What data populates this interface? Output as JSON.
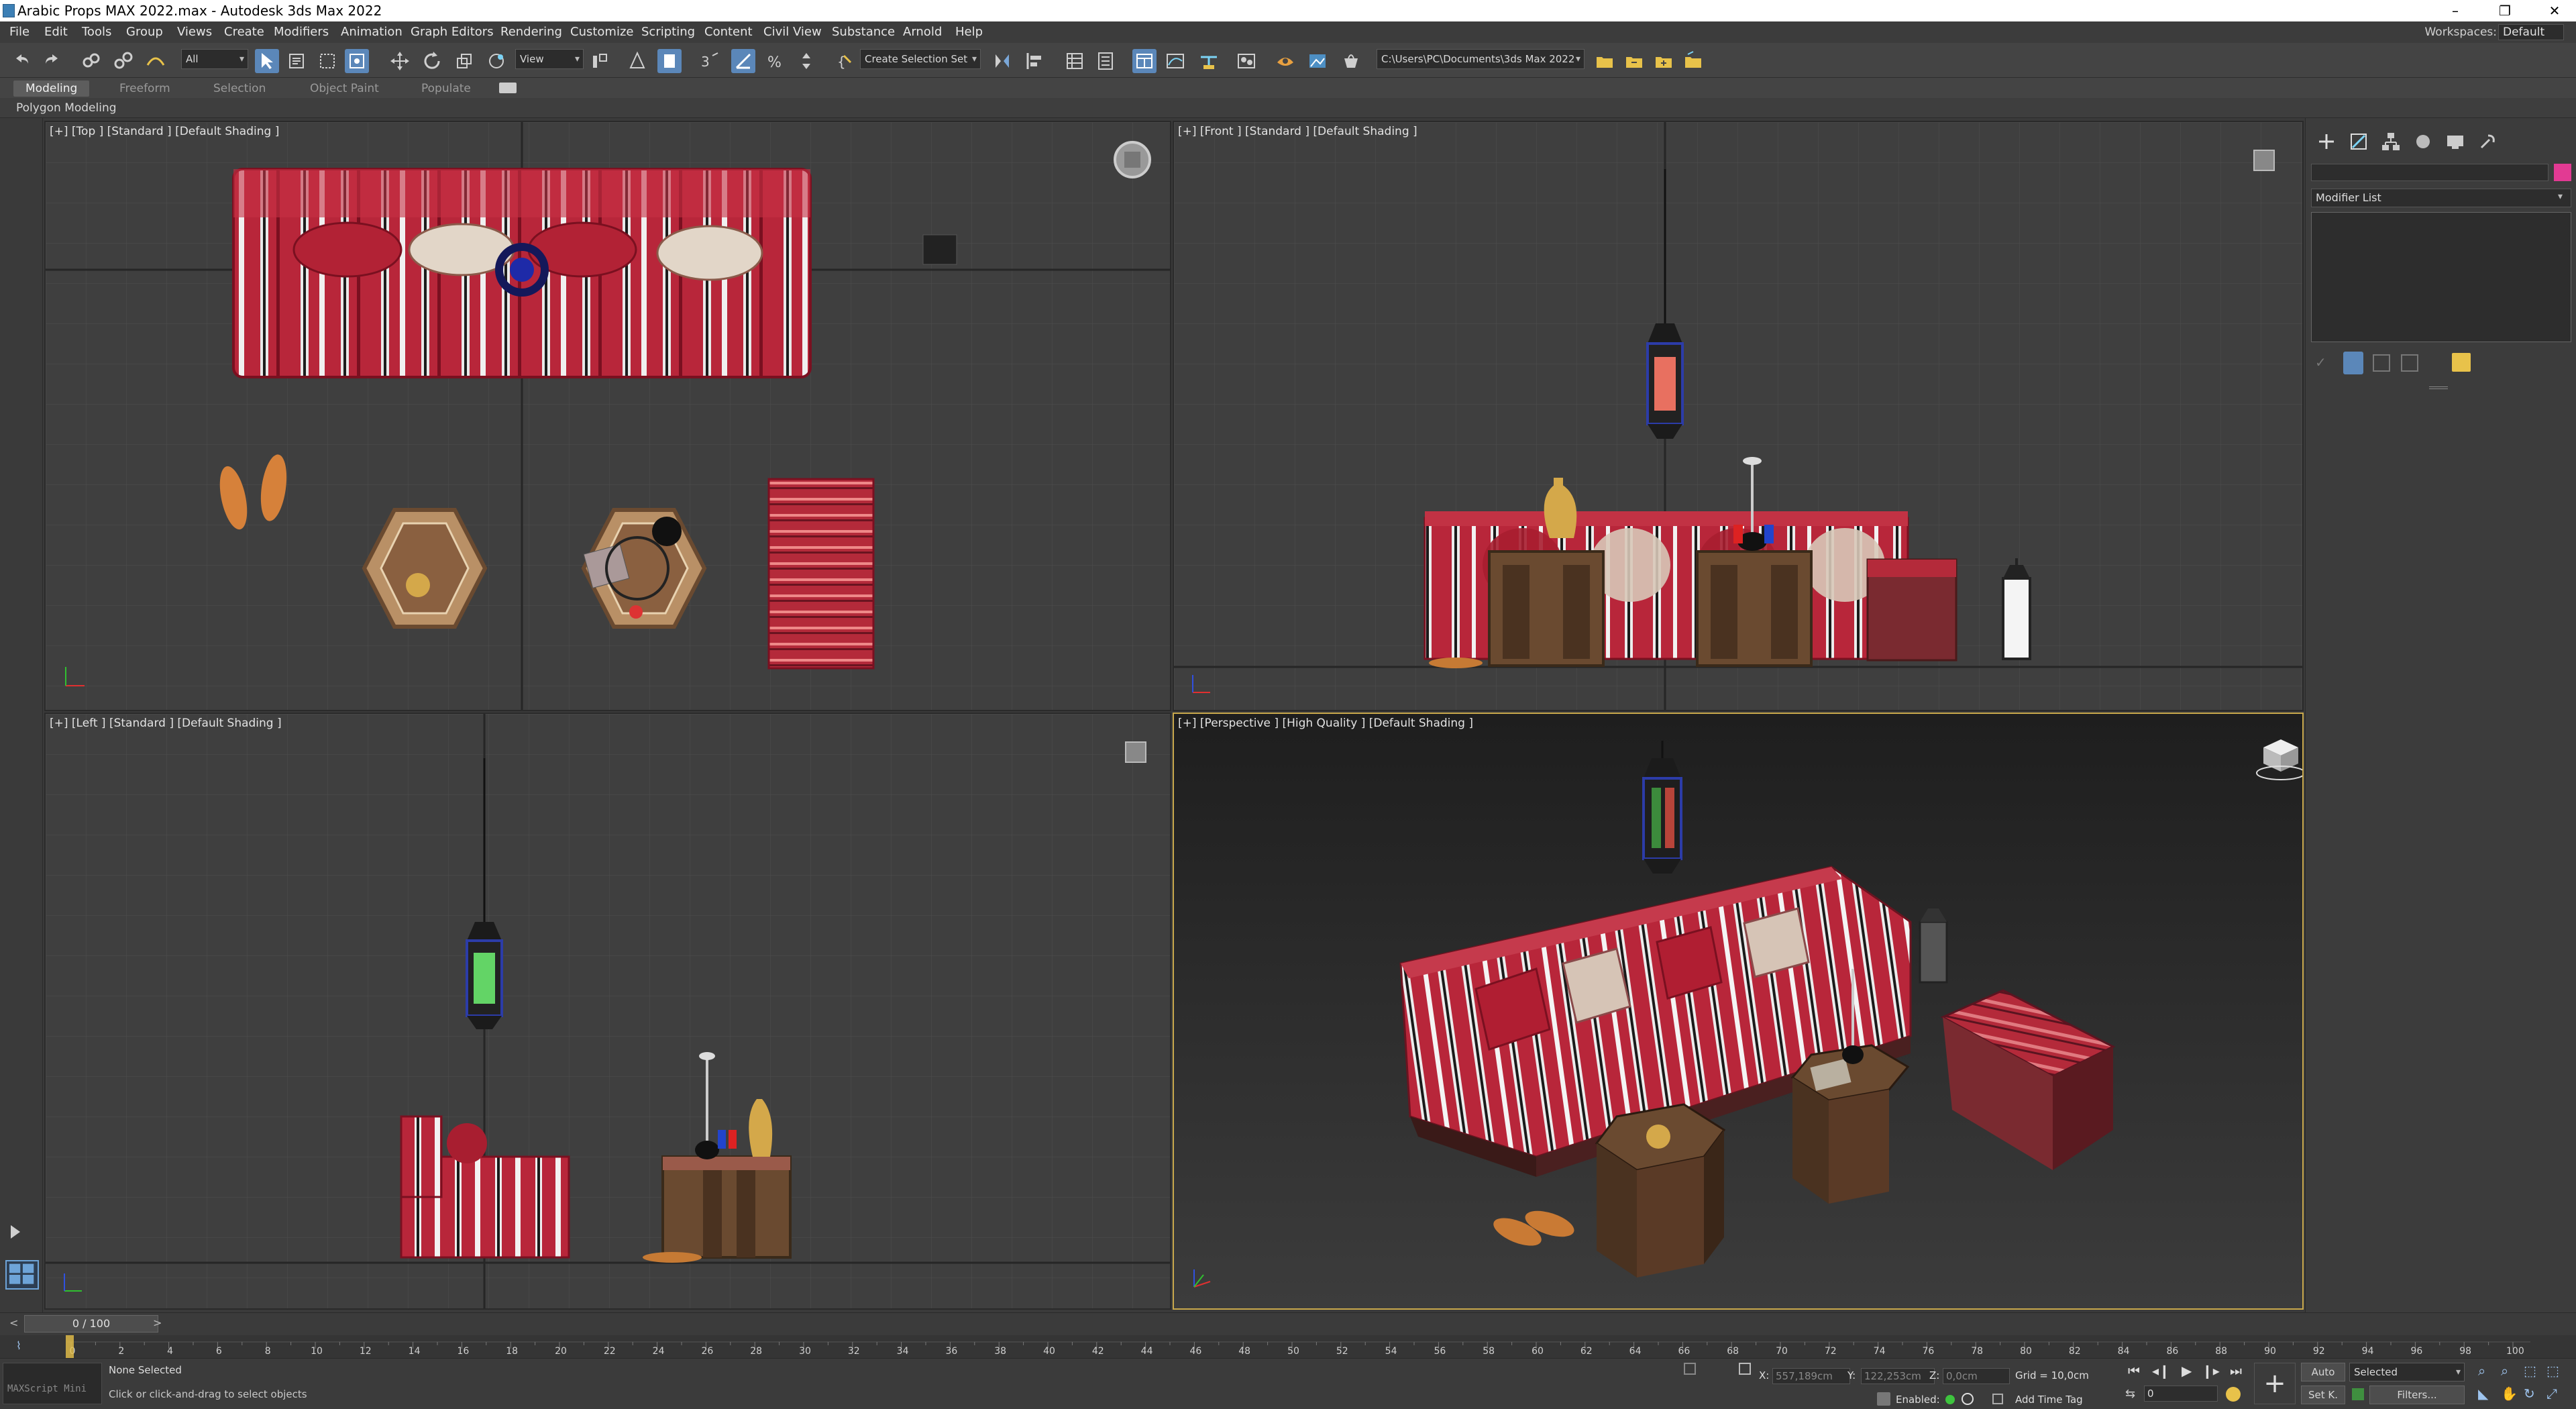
{
  "window": {
    "title": "Arabic Props MAX 2022.max - Autodesk 3ds Max 2022",
    "minimize": "–",
    "restore": "❐",
    "close": "✕"
  },
  "menus": [
    "File",
    "Edit",
    "Tools",
    "Group",
    "Views",
    "Create",
    "Modifiers",
    "Animation",
    "Graph Editors",
    "Rendering",
    "Customize",
    "Scripting",
    "Content",
    "Civil View",
    "Substance",
    "Arnold",
    "Help"
  ],
  "workspace": {
    "label": "Workspaces:",
    "value": "Default"
  },
  "toolbar": {
    "filter": "All",
    "view_dropdown": "View",
    "named_selection": "Create Selection Set",
    "project_path": "C:\\Users\\PC\\Documents\\3ds Max 2022"
  },
  "ribbon": {
    "tabs": [
      "Modeling",
      "Freeform",
      "Selection",
      "Object Paint",
      "Populate"
    ],
    "active_tab": "Modeling",
    "panel": "Polygon Modeling"
  },
  "viewports": {
    "top": {
      "label": "[+] [Top ] [Standard ] [Default Shading ]"
    },
    "front": {
      "label": "[+] [Front ] [Standard ] [Default Shading ]"
    },
    "left": {
      "label": "[+] [Left ] [Standard ] [Default Shading ]"
    },
    "perspective": {
      "label": "[+] [Perspective ] [High Quality ] [Default Shading ]"
    }
  },
  "command_panel": {
    "modifier_list": "Modifier List",
    "swatch_color": "#e23a93"
  },
  "timeline": {
    "frame": "0 / 100",
    "ticks": [
      "0",
      "2",
      "4",
      "6",
      "8",
      "10",
      "12",
      "14",
      "16",
      "18",
      "20",
      "22",
      "24",
      "26",
      "28",
      "30",
      "32",
      "34",
      "36",
      "38",
      "40",
      "42",
      "44",
      "46",
      "48",
      "50",
      "52",
      "54",
      "56",
      "58",
      "60",
      "62",
      "64",
      "66",
      "68",
      "70",
      "72",
      "74",
      "76",
      "78",
      "80",
      "82",
      "84",
      "86",
      "88",
      "90",
      "92",
      "94",
      "96",
      "98",
      "100"
    ]
  },
  "status": {
    "selection": "None Selected",
    "prompt": "Click or click-and-drag to select objects",
    "maxscript": "MAXScript Mini",
    "x_label": "X:",
    "x_value": "557,189cm",
    "y_label": "Y:",
    "y_value": "122,253cm",
    "z_label": "Z:",
    "z_value": "0,0cm",
    "grid": "Grid = 10,0cm",
    "enabled_label": "Enabled:",
    "add_time_tag": "Add Time Tag",
    "auto": "Auto",
    "set_key": "Set K.",
    "key_filter": "Selected",
    "filters": "Filters...",
    "frame_field": "0"
  },
  "colors": {
    "fabric_red": "#b8263a",
    "wood": "#6a4a30",
    "brass": "#d4a84a",
    "viewport_bg": "#3f3f3f",
    "active_border": "#c8a84c"
  }
}
